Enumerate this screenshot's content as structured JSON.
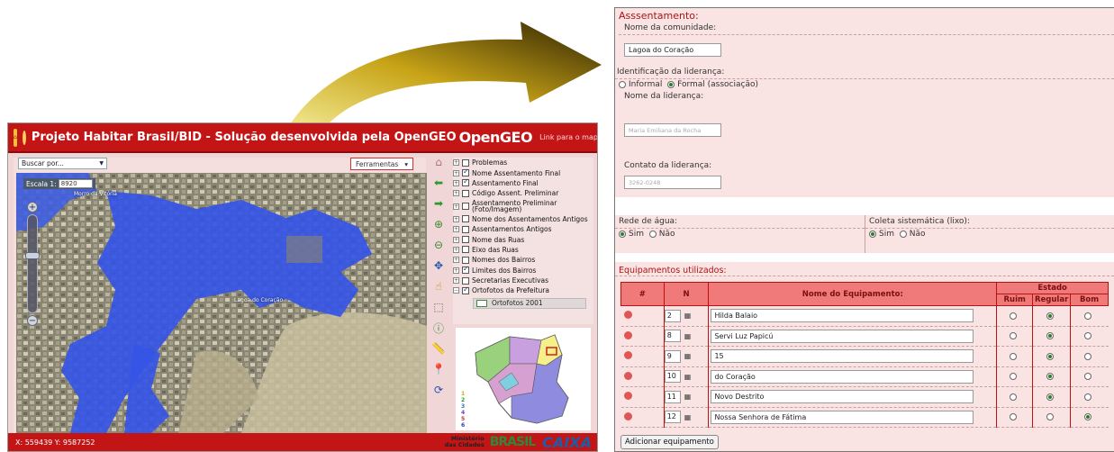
{
  "app": {
    "title": "Projeto Habitar Brasil/BID - Solução desenvolvida pela OpenGEO",
    "logo_brand": "OpenGEO",
    "map_link": "Link para o mapa atual",
    "search_select": "Buscar por...",
    "tools_label": "Ferramentas",
    "scale_label": "Escala 1:",
    "scale_value": "8920",
    "map_labels": [
      "Morro da Vitória",
      "Lagoa do Coração"
    ],
    "layers": [
      {
        "label": "Problemas",
        "checked": false
      },
      {
        "label": "Nome Assentamento Final",
        "checked": true
      },
      {
        "label": "Assentamento Final",
        "checked": true
      },
      {
        "label": "Código Assent. Preliminar",
        "checked": false
      },
      {
        "label": "Assentamento Preliminar (Foto/Imagem)",
        "checked": false
      },
      {
        "label": "Nome dos Assentamentos Antigos",
        "checked": false
      },
      {
        "label": "Assentamentos Antigos",
        "checked": false
      },
      {
        "label": "Nome das Ruas",
        "checked": false
      },
      {
        "label": "Eixo das Ruas",
        "checked": false
      },
      {
        "label": "Nomes dos Bairros",
        "checked": false
      },
      {
        "label": "Limites dos Bairros",
        "checked": true
      },
      {
        "label": "Secretarias Executivas",
        "checked": false
      },
      {
        "label": "Ortofotos da Prefeitura",
        "checked": true
      }
    ],
    "sublayer": "Ortofotos 2001",
    "legend": [
      "1",
      "2",
      "3",
      "4",
      "5",
      "6"
    ],
    "coords": "X: 559439   Y: 9587252",
    "footer_ministry": [
      "Ministério",
      "das Cidades"
    ],
    "footer_brasil": "BRASIL",
    "footer_caixa": "CAIXA"
  },
  "form": {
    "title": "Asssentamento:",
    "community_label": "Nome da comunidade:",
    "community_value": "Lagoa do Coração",
    "leadership_id_label": "Identificação da liderança:",
    "leadership_options": [
      "Informal",
      "Formal (associação)"
    ],
    "leadership_selected": "Formal (associação)",
    "leader_name_label": "Nome da liderança:",
    "leader_name_value": "Maria Emiliana da Rocha",
    "leader_contact_label": "Contato da liderança:",
    "leader_contact_value": "3262-0248",
    "water_label": "Rede de água:",
    "water_options": [
      "Sim",
      "Não"
    ],
    "water_selected": "Sim",
    "waste_label": "Coleta sistemática (lixo):",
    "waste_options": [
      "Sim",
      "Não"
    ],
    "waste_selected": "Sim",
    "equip_title": "Equipamentos utilizados:",
    "table_headers": {
      "hash": "#",
      "n": "N",
      "name": "Nome do Equipamento:",
      "estado": "Estado",
      "ruim": "Ruim",
      "regular": "Regular",
      "bom": "Bom"
    },
    "rows": [
      {
        "n": "2",
        "name": "Hilda Balaio",
        "state": "Regular"
      },
      {
        "n": "8",
        "name": "Servi Luz Papicú",
        "state": "Regular"
      },
      {
        "n": "9",
        "name": "15",
        "state": "Regular"
      },
      {
        "n": "10",
        "name": "do Coração",
        "state": "Regular"
      },
      {
        "n": "11",
        "name": "Novo Destrito",
        "state": "Regular"
      },
      {
        "n": "12",
        "name": "Nossa Senhora de Fátima",
        "state": "Bom"
      }
    ],
    "add_button": "Adicionar equipamento"
  }
}
